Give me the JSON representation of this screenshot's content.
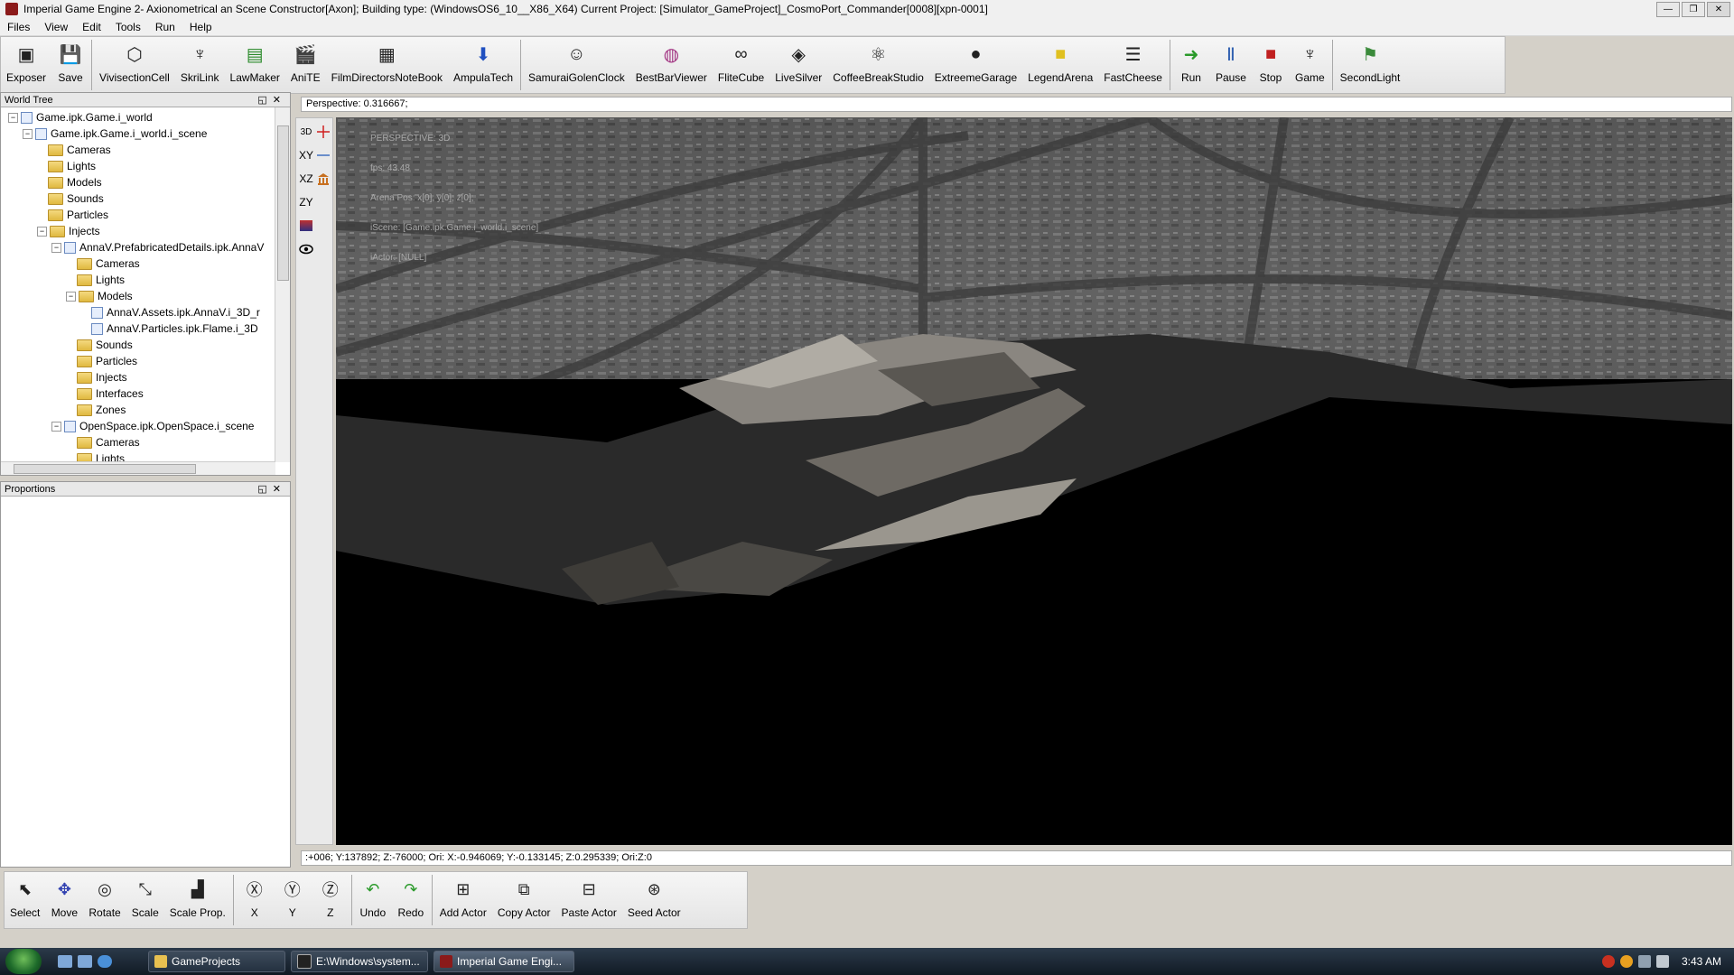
{
  "window": {
    "title": "Imperial Game Engine 2- Axionometrical an Scene Constructor[Axon]; Building type: (WindowsOS6_10__X86_X64) Current Project: [Simulator_GameProject]_CosmoPort_Commander[0008][xpn-0001]"
  },
  "menu": [
    "Files",
    "View",
    "Edit",
    "Tools",
    "Run",
    "Help"
  ],
  "toolbar": [
    {
      "label": "Exposer",
      "icon": "exposer-icon"
    },
    {
      "label": "Save",
      "icon": "floppy-disk-icon"
    },
    {
      "label": "VivisectionCell",
      "icon": "wireframe-cube-icon"
    },
    {
      "label": "SkriLink",
      "icon": "eagle-emblem-icon"
    },
    {
      "label": "LawMaker",
      "icon": "green-chart-icon"
    },
    {
      "label": "AniTE",
      "icon": "clapperboard-icon"
    },
    {
      "label": "FilmDirectorsNoteBook",
      "icon": "film-strip-icon"
    },
    {
      "label": "AmpulaTech",
      "icon": "ampula-icon"
    },
    {
      "label": "SamuraiGolenClock",
      "icon": "masks-icon"
    },
    {
      "label": "BestBarViewer",
      "icon": "barrel-icon"
    },
    {
      "label": "FliteCube",
      "icon": "loop-icon"
    },
    {
      "label": "LiveSilver",
      "icon": "diamond-icon"
    },
    {
      "label": "CoffeeBreakStudio",
      "icon": "atom-icon"
    },
    {
      "label": "ExtreemeGarage",
      "icon": "spheres-icon"
    },
    {
      "label": "LegendArena",
      "icon": "arena-icon"
    },
    {
      "label": "FastCheese",
      "icon": "sliders-icon"
    },
    {
      "label": "Run",
      "icon": "run-icon"
    },
    {
      "label": "Pause",
      "icon": "pause-icon"
    },
    {
      "label": "Stop",
      "icon": "stop-icon"
    },
    {
      "label": "Game",
      "icon": "game-eagle-icon"
    },
    {
      "label": "SecondLight",
      "icon": "lamp-icon"
    }
  ],
  "world_tree": {
    "title": "World Tree",
    "nodes": [
      {
        "label": "Game.ipk.Game.i_world",
        "type": "world",
        "level": 0,
        "expander": "-"
      },
      {
        "label": "Game.ipk.Game.i_world.i_scene",
        "type": "scene",
        "level": 1,
        "expander": "-"
      },
      {
        "label": "Cameras",
        "type": "folder",
        "level": 2,
        "expander": ""
      },
      {
        "label": "Lights",
        "type": "folder",
        "level": 2,
        "expander": ""
      },
      {
        "label": "Models",
        "type": "folder",
        "level": 2,
        "expander": ""
      },
      {
        "label": "Sounds",
        "type": "folder",
        "level": 2,
        "expander": ""
      },
      {
        "label": "Particles",
        "type": "folder",
        "level": 2,
        "expander": ""
      },
      {
        "label": "Injects",
        "type": "folder",
        "level": 2,
        "expander": "-"
      },
      {
        "label": "AnnaV.PrefabricatedDetails.ipk.AnnaV",
        "type": "scene",
        "level": 3,
        "expander": "-"
      },
      {
        "label": "Cameras",
        "type": "folder",
        "level": 4,
        "expander": ""
      },
      {
        "label": "Lights",
        "type": "folder",
        "level": 4,
        "expander": ""
      },
      {
        "label": "Models",
        "type": "folder",
        "level": 4,
        "expander": "-"
      },
      {
        "label": "AnnaV.Assets.ipk.AnnaV.i_3D_r",
        "type": "scene",
        "level": 5,
        "expander": ""
      },
      {
        "label": "AnnaV.Particles.ipk.Flame.i_3D",
        "type": "scene",
        "level": 5,
        "expander": ""
      },
      {
        "label": "Sounds",
        "type": "folder",
        "level": 4,
        "expander": ""
      },
      {
        "label": "Particles",
        "type": "folder",
        "level": 4,
        "expander": ""
      },
      {
        "label": "Injects",
        "type": "folder",
        "level": 4,
        "expander": ""
      },
      {
        "label": "Interfaces",
        "type": "folder",
        "level": 4,
        "expander": ""
      },
      {
        "label": "Zones",
        "type": "folder",
        "level": 4,
        "expander": ""
      },
      {
        "label": "OpenSpace.ipk.OpenSpace.i_scene",
        "type": "scene",
        "level": 3,
        "expander": "-"
      },
      {
        "label": "Cameras",
        "type": "folder",
        "level": 4,
        "expander": ""
      },
      {
        "label": "Lights",
        "type": "folder",
        "level": 4,
        "expander": ""
      }
    ]
  },
  "proportions": {
    "title": "Proportions"
  },
  "viewport": {
    "perspective_value": "Perspective: 0.316667;",
    "hud": [
      "PERSPECTIVE: 3D",
      "fps: 43.48",
      "Arena Pos: x[0]; y[0]; z[0];",
      "iScene: [Game.ipk.Game.i_world.i_scene]",
      "iActor: [NULL]"
    ],
    "view_modes": [
      "3D",
      "XY",
      "XZ",
      "ZY"
    ],
    "coords": ":+006; Y:137892; Z:-76000; Ori: X:-0.946069; Y:-0.133145; Z:0.295339; Ori:Z:0"
  },
  "bottom_toolbar": [
    {
      "label": "Select",
      "icon": "cursor-icon"
    },
    {
      "label": "Move",
      "icon": "move-axes-icon"
    },
    {
      "label": "Rotate",
      "icon": "rotate-icon"
    },
    {
      "label": "Scale",
      "icon": "scale-icon"
    },
    {
      "label": "Scale Prop.",
      "icon": "scale-prop-icon"
    },
    {
      "label": "X",
      "icon": "axis-x-icon"
    },
    {
      "label": "Y",
      "icon": "axis-y-icon"
    },
    {
      "label": "Z",
      "icon": "axis-z-icon"
    },
    {
      "label": "Undo",
      "icon": "undo-icon"
    },
    {
      "label": "Redo",
      "icon": "redo-icon"
    },
    {
      "label": "Add Actor",
      "icon": "add-actor-icon"
    },
    {
      "label": "Copy Actor",
      "icon": "copy-actor-icon"
    },
    {
      "label": "Paste Actor",
      "icon": "paste-actor-icon"
    },
    {
      "label": "Seed Actor",
      "icon": "seed-actor-icon"
    }
  ],
  "taskbar": {
    "tasks": [
      {
        "label": "GameProjects",
        "active": false
      },
      {
        "label": "E:\\Windows\\system...",
        "active": false
      },
      {
        "label": "Imperial Game Engi...",
        "active": true
      }
    ],
    "clock": "3:43 AM"
  },
  "colors": {
    "toolbar_bg": "#ececec",
    "viewport_bg": "#000000",
    "taskbar_bg": "#1b2633"
  }
}
